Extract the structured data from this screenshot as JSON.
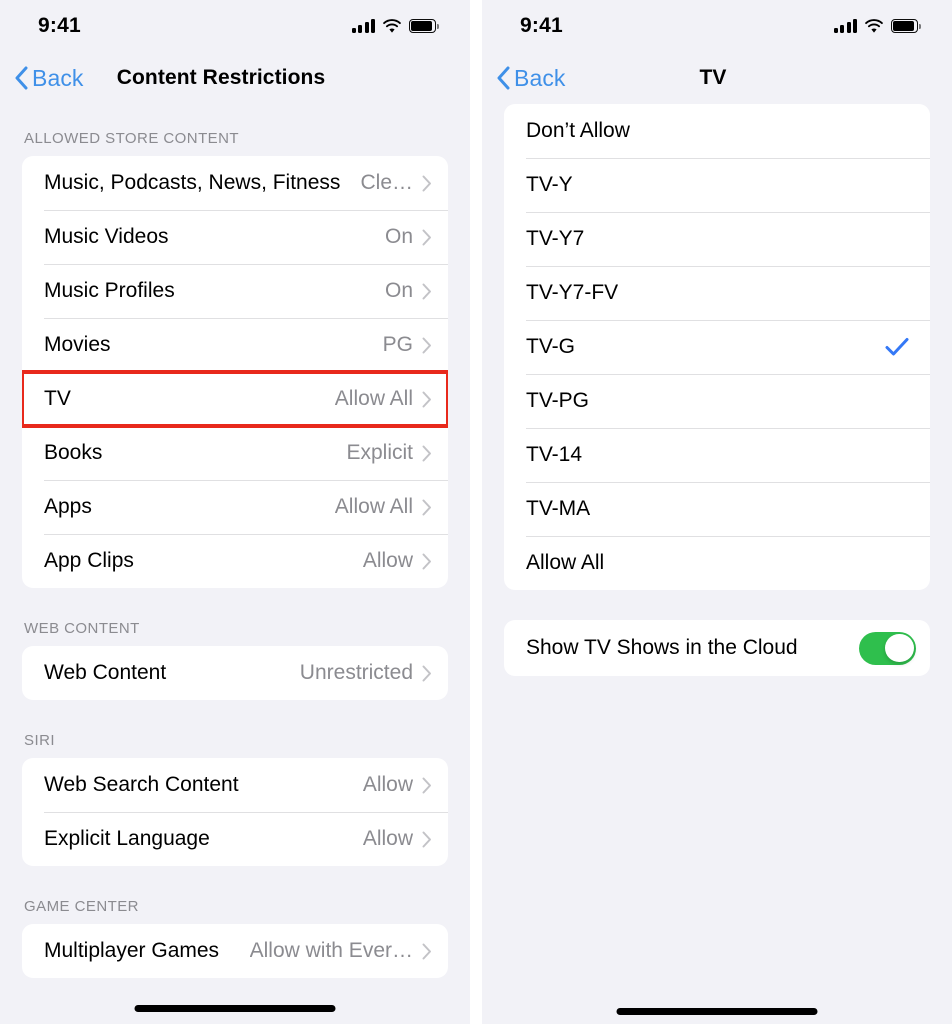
{
  "left_screen": {
    "status_bar": {
      "time": "9:41",
      "cellular_icon": "cellular-bars-icon",
      "wifi_icon": "wifi-icon",
      "battery_icon": "battery-full-icon"
    },
    "nav": {
      "back_label": "Back",
      "back_icon": "chevron-left-icon",
      "title": "Content Restrictions"
    },
    "sections": [
      {
        "header": "ALLOWED STORE CONTENT",
        "rows": [
          {
            "label": "Music, Podcasts, News, Fitness",
            "value": "Cle…",
            "chevron": "chevron-right-icon",
            "highlighted": false
          },
          {
            "label": "Music Videos",
            "value": "On",
            "chevron": "chevron-right-icon",
            "highlighted": false
          },
          {
            "label": "Music Profiles",
            "value": "On",
            "chevron": "chevron-right-icon",
            "highlighted": false
          },
          {
            "label": "Movies",
            "value": "PG",
            "chevron": "chevron-right-icon",
            "highlighted": false
          },
          {
            "label": "TV",
            "value": "Allow All",
            "chevron": "chevron-right-icon",
            "highlighted": true
          },
          {
            "label": "Books",
            "value": "Explicit",
            "chevron": "chevron-right-icon",
            "highlighted": false
          },
          {
            "label": "Apps",
            "value": "Allow All",
            "chevron": "chevron-right-icon",
            "highlighted": false
          },
          {
            "label": "App Clips",
            "value": "Allow",
            "chevron": "chevron-right-icon",
            "highlighted": false
          }
        ]
      },
      {
        "header": "WEB CONTENT",
        "rows": [
          {
            "label": "Web Content",
            "value": "Unrestricted",
            "chevron": "chevron-right-icon",
            "highlighted": false
          }
        ]
      },
      {
        "header": "SIRI",
        "rows": [
          {
            "label": "Web Search Content",
            "value": "Allow",
            "chevron": "chevron-right-icon",
            "highlighted": false
          },
          {
            "label": "Explicit Language",
            "value": "Allow",
            "chevron": "chevron-right-icon",
            "highlighted": false
          }
        ]
      },
      {
        "header": "GAME CENTER",
        "rows": [
          {
            "label": "Multiplayer Games",
            "value": "Allow with Ever…",
            "chevron": "chevron-right-icon",
            "highlighted": false
          }
        ]
      }
    ],
    "highlight_color": "#e8291c"
  },
  "right_screen": {
    "status_bar": {
      "time": "9:41",
      "cellular_icon": "cellular-bars-icon",
      "wifi_icon": "wifi-icon",
      "battery_icon": "battery-full-icon"
    },
    "nav": {
      "back_label": "Back",
      "back_icon": "chevron-left-icon",
      "title": "TV"
    },
    "rating_options": [
      {
        "label": "Don’t Allow",
        "selected": false
      },
      {
        "label": "TV-Y",
        "selected": false
      },
      {
        "label": "TV-Y7",
        "selected": false
      },
      {
        "label": "TV-Y7-FV",
        "selected": false
      },
      {
        "label": "TV-G",
        "selected": true
      },
      {
        "label": "TV-PG",
        "selected": false
      },
      {
        "label": "TV-14",
        "selected": false
      },
      {
        "label": "TV-MA",
        "selected": false
      },
      {
        "label": "Allow All",
        "selected": false
      }
    ],
    "toggle_row": {
      "label": "Show TV Shows in the Cloud",
      "state": "on"
    },
    "checkmark_color": "#3478f6",
    "toggle_on_color": "#2fbf4d"
  }
}
